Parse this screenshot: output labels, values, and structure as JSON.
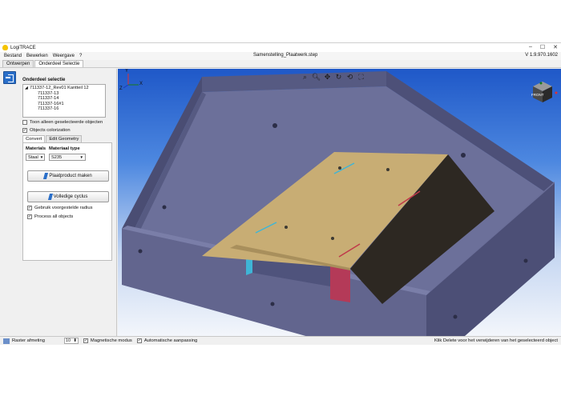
{
  "window": {
    "title": "LogiTRACE",
    "controls": {
      "minimize": "–",
      "maximize": "☐",
      "close": "✕"
    }
  },
  "menubar": {
    "items": [
      "Bestand",
      "Bewerken",
      "Weergave",
      "?"
    ],
    "document_title": "Samenstelling_Plaatwerk.step",
    "version": "V 1.9.970.1602"
  },
  "tabs": [
    {
      "label": "Ontwerpen",
      "active": false
    },
    {
      "label": "Onderdeel Selectie",
      "active": true
    }
  ],
  "left_panel": {
    "section_title": "Onderdeel selectie",
    "tree": {
      "root": "711337-12_Rev01 Kantteil 12",
      "children": [
        "711337-13",
        "711337-14",
        "711337-16#1",
        "711337-16"
      ]
    },
    "show_selected_label": "Toon alleen geselecteerde objecten",
    "show_selected_checked": false,
    "colorization_label": "Objects colorization",
    "colorization_checked": true,
    "subtabs": [
      {
        "label": "Convert",
        "active": true
      },
      {
        "label": "Edit Geometry",
        "active": false
      }
    ],
    "materials_label": "Materials",
    "material_type_label": "Materiaal type",
    "material_value": "Staal",
    "material_type_value": "S235",
    "make_sheet_button": "Plaatproduct maken",
    "full_cycle_button": "Volledige cyclus",
    "use_radius_label": "Gebruik voorgestelde radius",
    "use_radius_checked": true,
    "process_all_label": "Process all objects",
    "process_all_checked": true
  },
  "viewport": {
    "axis_labels": {
      "y": "Y",
      "x": "X",
      "z": "Z"
    },
    "toolbar_icons": [
      "zoom-region-icon",
      "zoom-icon",
      "pan-icon",
      "rotate-icon",
      "rotate-view-icon",
      "fit-all-icon"
    ],
    "view_cube_face": "FRONT",
    "colors": {
      "box_wall": "#5c5f85",
      "box_wall_dark": "#3e4064",
      "box_floor": "#6a6e98",
      "plate": "#c5aa72",
      "slope_dark": "#2f2a24",
      "highlight_cyan": "#3fb5d6",
      "highlight_red": "#c0384a"
    }
  },
  "statusbar": {
    "grid_label": "Raster afmeting",
    "grid_value": "10",
    "magnetic_label": "Magnetische modus",
    "magnetic_checked": true,
    "auto_adjust_label": "Automatische aanpassing",
    "auto_adjust_checked": true,
    "hint": "Klik Delete voor het verwijderen van het geselecteerd object"
  }
}
